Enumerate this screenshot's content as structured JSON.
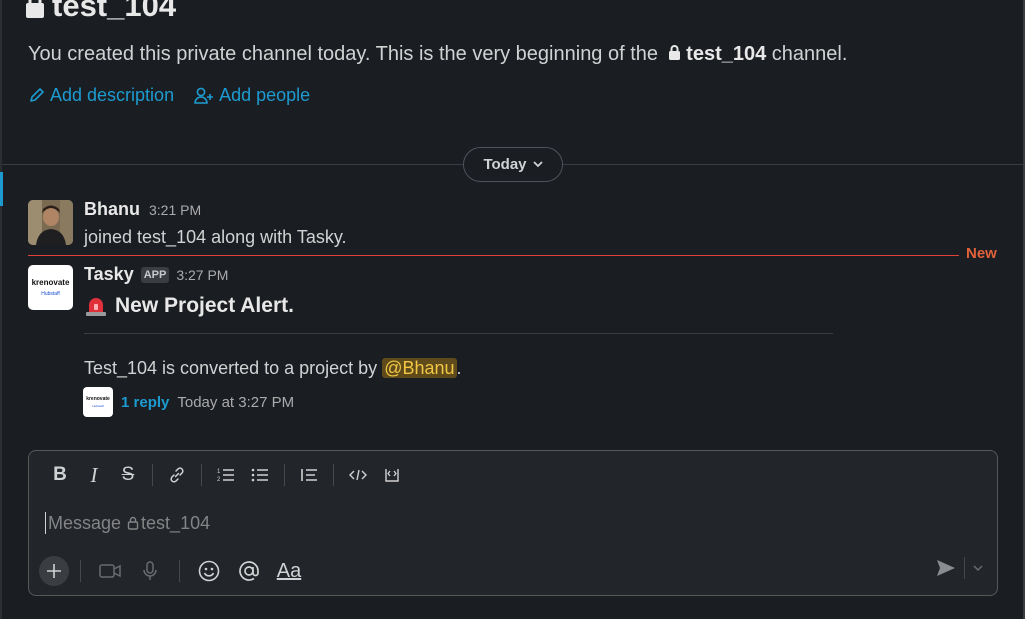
{
  "channel": {
    "name": "test_104",
    "intro_prefix": "You created this private channel today. This is the very beginning of the",
    "intro_suffix": "channel."
  },
  "actions": {
    "add_description": "Add description",
    "add_people": "Add people"
  },
  "day_divider": {
    "label": "Today"
  },
  "messages": [
    {
      "author": "Bhanu",
      "time": "3:21 PM",
      "text": "joined test_104 along with Tasky."
    },
    {
      "author": "Tasky",
      "badge": "APP",
      "time": "3:27 PM",
      "title": "New Project Alert.",
      "body_prefix": "Test_104 is converted to a project by",
      "mention": "@Bhanu",
      "body_suffix": ".",
      "thread": {
        "reply_count": "1 reply",
        "last_reply": "Today at 3:27 PM"
      }
    }
  ],
  "bot_avatar": {
    "line1": "krenovate",
    "line2": "Hubstaff"
  },
  "new_marker": "New",
  "composer": {
    "placeholder_prefix": "Message",
    "placeholder_channel": "test_104",
    "format_underline_label": "Aa"
  },
  "colors": {
    "accent_link": "#1d9bd1",
    "new_line": "#e0423b",
    "mention_bg": "#5e4a1b",
    "mention_fg": "#f2c744"
  }
}
